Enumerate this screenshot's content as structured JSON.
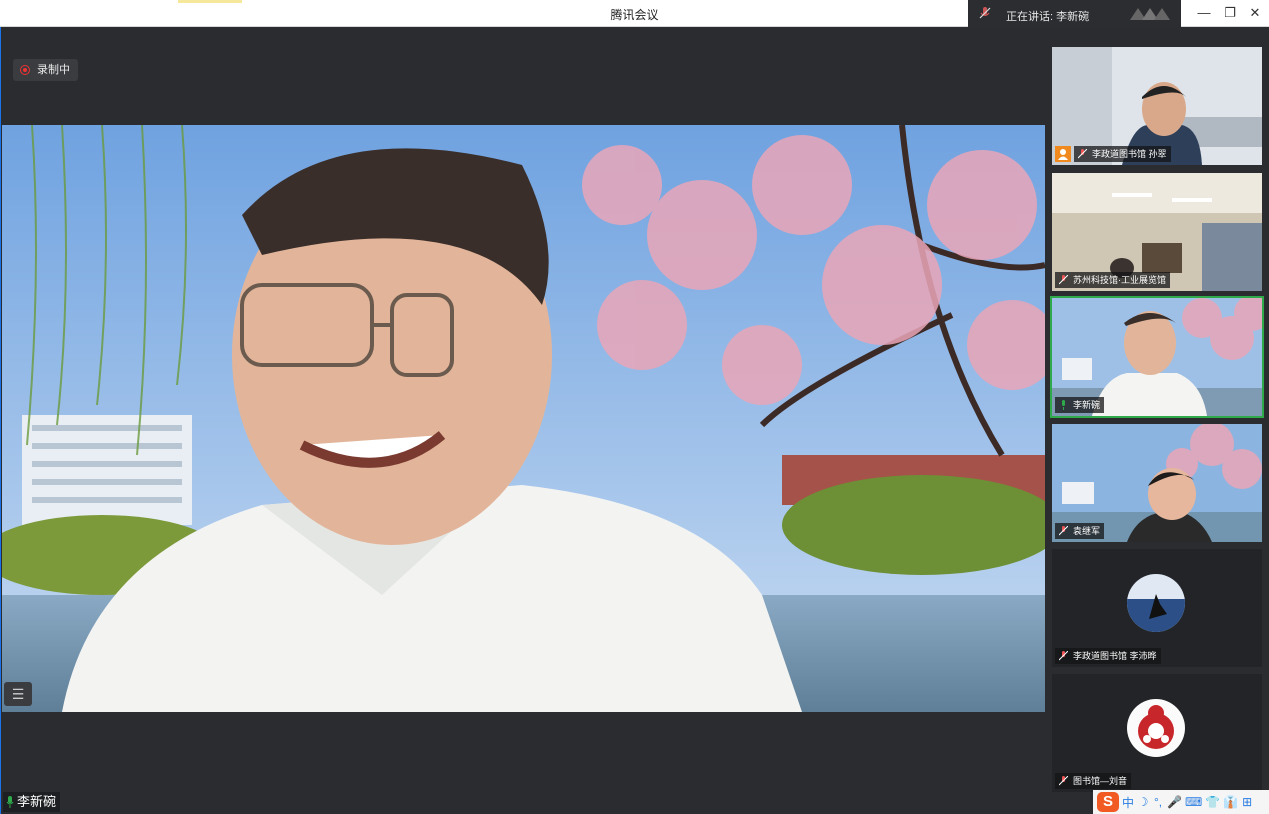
{
  "window": {
    "title": "腾讯会议",
    "speaking_label": "正在讲话: 李新碗",
    "controls": {
      "minimize": "—",
      "restore": "❐",
      "close": "✕"
    }
  },
  "main": {
    "recording_label": "录制中",
    "list_icon": "☰",
    "speaker_name": "李新碗"
  },
  "participants": [
    {
      "label": "李政道图书馆 孙翠",
      "host": true,
      "active": false
    },
    {
      "label": "苏州科技馆·工业展览馆",
      "host": false,
      "active": false
    },
    {
      "label": "李新碗",
      "host": false,
      "active": true
    },
    {
      "label": "袁继军",
      "host": false,
      "active": false
    },
    {
      "label": "李政道图书馆 李沛晔",
      "host": false,
      "active": false
    },
    {
      "label": "图书馆—刘音",
      "host": false,
      "active": false
    }
  ],
  "taskbar": {
    "ime_logo": "S",
    "ime_mode": "中",
    "items": [
      "☽",
      "°,",
      "🎤",
      "⌨",
      "👕",
      "👔",
      "⊞"
    ]
  },
  "colors": {
    "accent": "#1a73e8",
    "active_border": "#2eaa4b",
    "recording": "#e33",
    "host_badge": "#f08a1e"
  }
}
